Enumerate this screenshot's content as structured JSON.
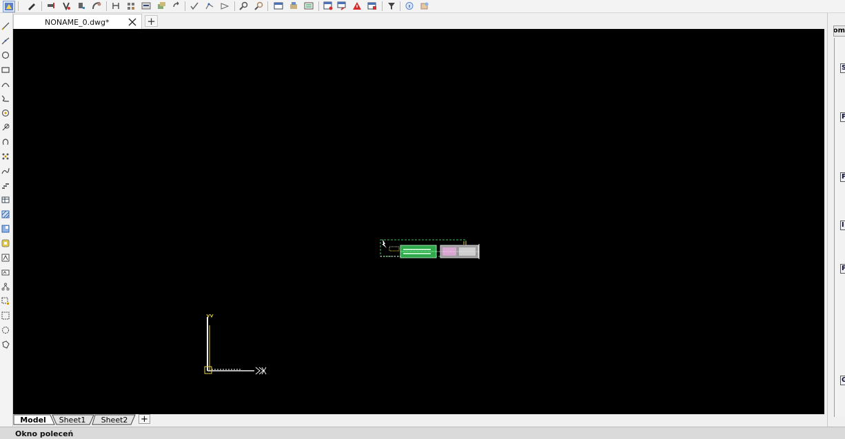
{
  "toolbar": {
    "icons": [
      "app-logo-icon",
      "pencil-icon",
      "extend-icon",
      "trim-icon",
      "break-icon",
      "fillet-icon",
      "mirror-icon",
      "array-icon",
      "layer-props-icon",
      "layer-state-icon",
      "rotate-icon",
      "check-icon",
      "polyline-vertex-icon",
      "triangle-arrow-icon",
      "zoom-icon",
      "zoom-realtime-icon",
      "table-icon",
      "insert-block-icon",
      "attribute-icon",
      "report-icon",
      "redraw-icon",
      "warning-icon",
      "audit-icon",
      "filter-icon",
      "info-icon",
      "render-icon"
    ]
  },
  "left_toolbar": {
    "icons": [
      "line-icon",
      "polyline-icon",
      "circle-icon",
      "rectangle-icon",
      "arc-icon",
      "spline-icon",
      "donut-icon",
      "revcloud-icon",
      "ellipse-icon",
      "point-icon",
      "spline-fit-icon",
      "multiline-icon",
      "table-tool-icon",
      "hatch-icon",
      "gradient-icon",
      "region-icon",
      "text-icon",
      "mtext-icon",
      "block-icon",
      "select-window-icon",
      "select-crossing-icon",
      "select-circle-icon",
      "select-polygon-icon"
    ]
  },
  "tabs": {
    "document_title": "NONAME_0.dwg*",
    "new_tab_symbol": "+"
  },
  "sheet_tabs": [
    {
      "label": "Model",
      "active": true
    },
    {
      "label": "Sheet1",
      "active": false
    },
    {
      "label": "Sheet2",
      "active": false
    }
  ],
  "sheet_add_symbol": "+",
  "command_window": {
    "label": "Okno poleceń"
  },
  "right_panel": {
    "title": "om",
    "categories": [
      "S",
      "P",
      "P",
      "I",
      "P",
      "G"
    ]
  },
  "colors": {
    "canvas_background": "#000000",
    "ucs_axis": "#f2f2f2",
    "ucs_marker": "#e6d44a",
    "block_green": "#2ea84a",
    "block_gray": "#b9b9b9",
    "block_pink": "#d8a8d0"
  }
}
